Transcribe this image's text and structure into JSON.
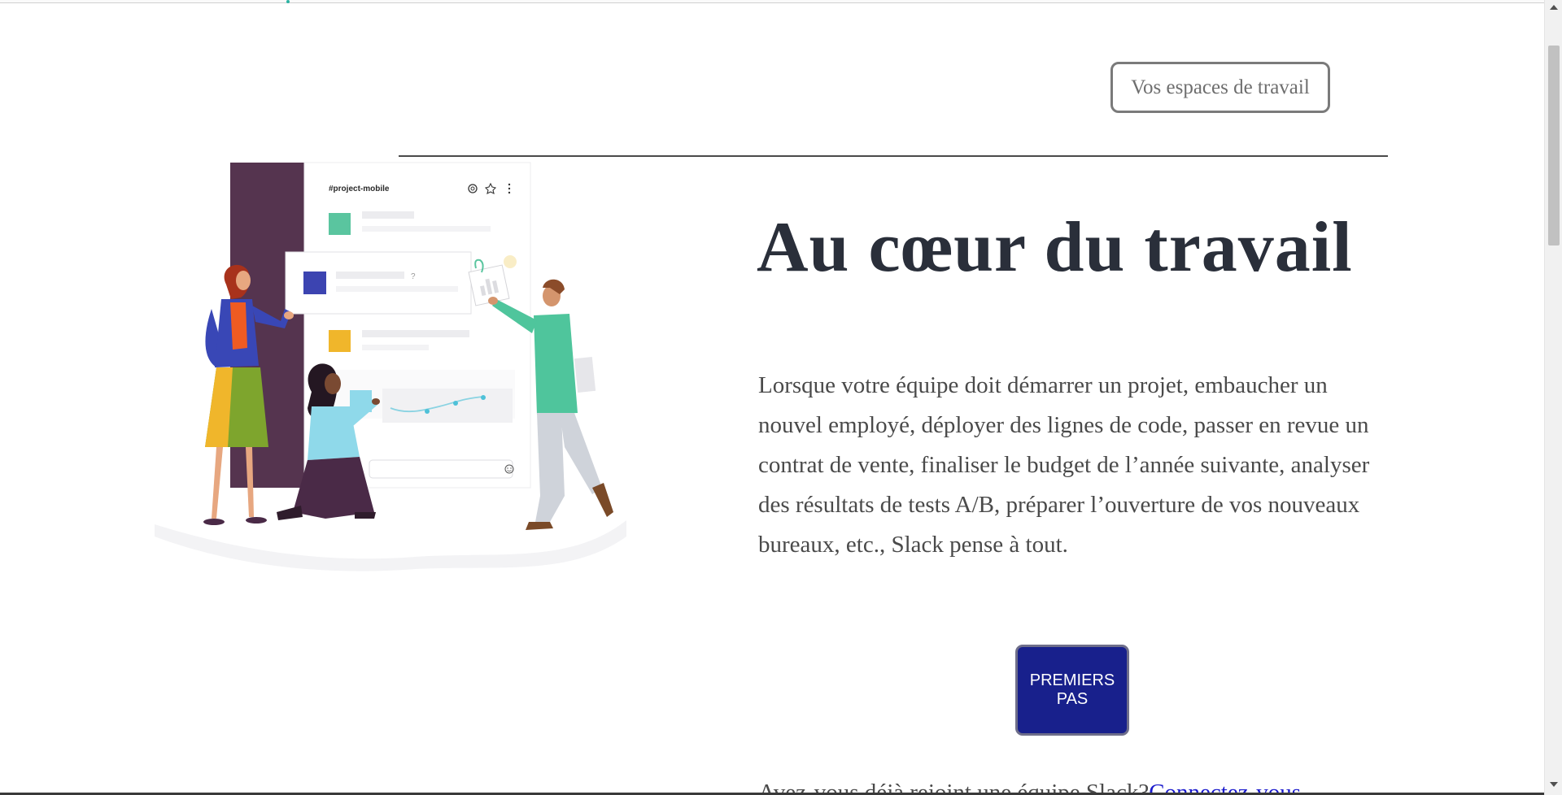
{
  "header": {
    "workspaces_label": "Vos espaces de travail"
  },
  "illustration": {
    "channel_name": "#project-mobile",
    "question_mark": "?",
    "colors": {
      "sidebar": "#55344f",
      "green": "#5ac59f",
      "blue": "#3c44b1",
      "yellow": "#f0b62b",
      "teal_shirt": "#4fc59c"
    }
  },
  "hero": {
    "title": "Au cœur du travail",
    "description": "Lorsque votre équipe doit démarrer un projet, embaucher un nouvel employé, déployer des lignes de code, passer en revue un contrat de vente, finaliser le budget de l’année suivante, analyser des résultats de tests A/B, préparer l’ouverture de vos nouveaux bureaux, etc., Slack pense à tout.",
    "cta_label": "PREMIERS PAS",
    "signin_prompt": "Avez-vous déjà rejoint une équipe Slack?",
    "signin_link": "Connectez-vous"
  },
  "colors": {
    "headline": "#2a2f3a",
    "body_text": "#4a4a4a",
    "cta_background": "#18208c",
    "link": "#1a1acc"
  }
}
